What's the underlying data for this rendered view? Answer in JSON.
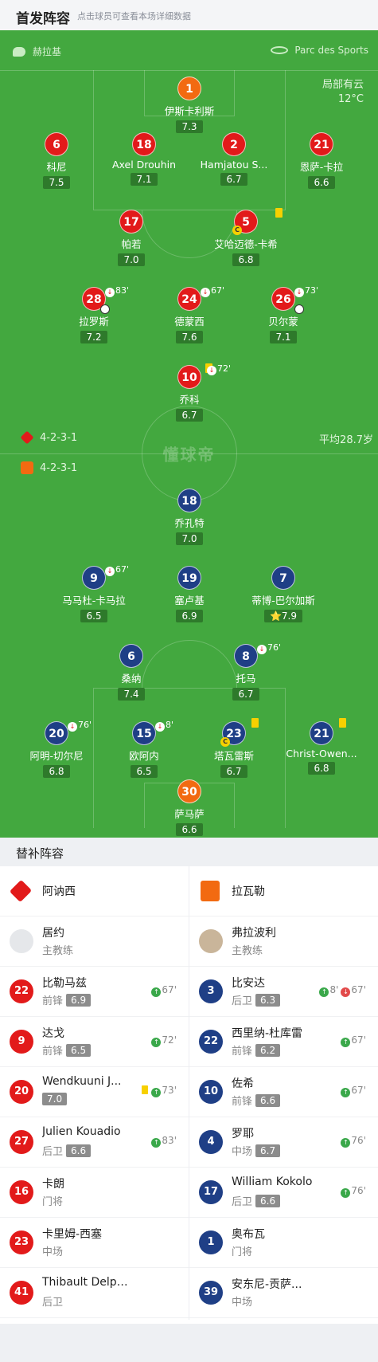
{
  "header": {
    "title": "首发阵容",
    "subtitle": "点击球员可查看本场详细数据"
  },
  "venue": {
    "referee": "赫拉基",
    "stadium": "Parc des Sports"
  },
  "weather": {
    "condition": "局部有云",
    "temp": "12°C"
  },
  "watermark": "懂球帝",
  "home": {
    "formation": "4-2-3-1",
    "avg_age": "平均28.7岁",
    "color": "#e21a1a"
  },
  "away": {
    "formation": "4-2-3-1",
    "color": "#1f3f86"
  },
  "home_players": [
    {
      "no": "1",
      "name": "伊斯卡利斯",
      "rating": "7.3",
      "gk": true
    },
    {
      "no": "6",
      "name": "科尼",
      "rating": "7.5"
    },
    {
      "no": "18",
      "name": "Axel Drouhin",
      "rating": "7.1"
    },
    {
      "no": "2",
      "name": "Hamjatou S...",
      "rating": "6.7"
    },
    {
      "no": "21",
      "name": "恩萨-卡拉",
      "rating": "6.6"
    },
    {
      "no": "17",
      "name": "帕若",
      "rating": "7.0"
    },
    {
      "no": "5",
      "name": "艾哈迈德-卡希",
      "rating": "6.8"
    },
    {
      "no": "28",
      "name": "拉罗斯",
      "rating": "7.2",
      "sub": "83'"
    },
    {
      "no": "24",
      "name": "德蒙西",
      "rating": "7.6",
      "sub": "67'"
    },
    {
      "no": "26",
      "name": "贝尔蒙",
      "rating": "7.1",
      "sub": "73'"
    },
    {
      "no": "10",
      "name": "乔科",
      "rating": "6.7",
      "sub": "72'"
    }
  ],
  "away_players": [
    {
      "no": "18",
      "name": "乔孔特",
      "rating": "7.0"
    },
    {
      "no": "9",
      "name": "马马杜-卡马拉",
      "rating": "6.5",
      "sub": "67'"
    },
    {
      "no": "19",
      "name": "塞卢基",
      "rating": "6.9"
    },
    {
      "no": "7",
      "name": "蒂博-巴尔加斯",
      "rating": "7.9"
    },
    {
      "no": "6",
      "name": "桑纳",
      "rating": "7.4"
    },
    {
      "no": "8",
      "name": "托马",
      "rating": "6.7",
      "sub": "76'"
    },
    {
      "no": "20",
      "name": "阿明-切尔尼",
      "rating": "6.8",
      "sub": "76'"
    },
    {
      "no": "15",
      "name": "欧阿内",
      "rating": "6.5",
      "sub": "8'"
    },
    {
      "no": "23",
      "name": "塔瓦雷斯",
      "rating": "6.7"
    },
    {
      "no": "21",
      "name": "Christ-Owen...",
      "rating": "6.8"
    },
    {
      "no": "30",
      "name": "萨马萨",
      "rating": "6.6",
      "gk": true
    }
  ],
  "bench_title": "替补阵容",
  "bench": {
    "home_team": "阿讷西",
    "away_team": "拉瓦勒",
    "home_coach": {
      "name": "居约",
      "role": "主教练"
    },
    "away_coach": {
      "name": "弗拉波利",
      "role": "主教练"
    },
    "home": [
      {
        "no": "22",
        "name": "比勒马兹",
        "pos": "前锋",
        "rating": "6.9",
        "events": [
          {
            "type": "up",
            "min": "67'"
          }
        ]
      },
      {
        "no": "9",
        "name": "达戈",
        "pos": "前锋",
        "rating": "6.5",
        "events": [
          {
            "type": "up",
            "min": "72'"
          }
        ]
      },
      {
        "no": "20",
        "name": "Wendkuuni J...",
        "pos": "",
        "rating": "7.0",
        "card": "yellow",
        "events": [
          {
            "type": "up",
            "min": "73'"
          }
        ]
      },
      {
        "no": "27",
        "name": "Julien Kouadio",
        "pos": "后卫",
        "rating": "6.6",
        "events": [
          {
            "type": "up",
            "min": "83'"
          }
        ]
      },
      {
        "no": "16",
        "name": "卡朗",
        "pos": "门将",
        "rating": "",
        "events": []
      },
      {
        "no": "23",
        "name": "卡里姆-西塞",
        "pos": "中场",
        "rating": "",
        "events": []
      },
      {
        "no": "41",
        "name": "Thibault Delphis",
        "pos": "后卫",
        "rating": "",
        "events": []
      }
    ],
    "away": [
      {
        "no": "3",
        "name": "比安达",
        "pos": "后卫",
        "rating": "6.3",
        "events": [
          {
            "type": "up",
            "min": "8'"
          },
          {
            "type": "dn",
            "min": "67'"
          }
        ]
      },
      {
        "no": "22",
        "name": "西里纳-杜库雷",
        "pos": "前锋",
        "rating": "6.2",
        "events": [
          {
            "type": "up",
            "min": "67'"
          }
        ]
      },
      {
        "no": "10",
        "name": "佐希",
        "pos": "前锋",
        "rating": "6.6",
        "events": [
          {
            "type": "up",
            "min": "67'"
          }
        ]
      },
      {
        "no": "4",
        "name": "罗耶",
        "pos": "中场",
        "rating": "6.7",
        "events": [
          {
            "type": "up",
            "min": "76'"
          }
        ]
      },
      {
        "no": "17",
        "name": "William Kokolo",
        "pos": "后卫",
        "rating": "6.6",
        "events": [
          {
            "type": "up",
            "min": "76'"
          }
        ]
      },
      {
        "no": "1",
        "name": "奥布瓦",
        "pos": "门将",
        "rating": "",
        "events": []
      },
      {
        "no": "39",
        "name": "安东尼-贡萨...",
        "pos": "中场",
        "rating": "",
        "events": []
      }
    ]
  }
}
